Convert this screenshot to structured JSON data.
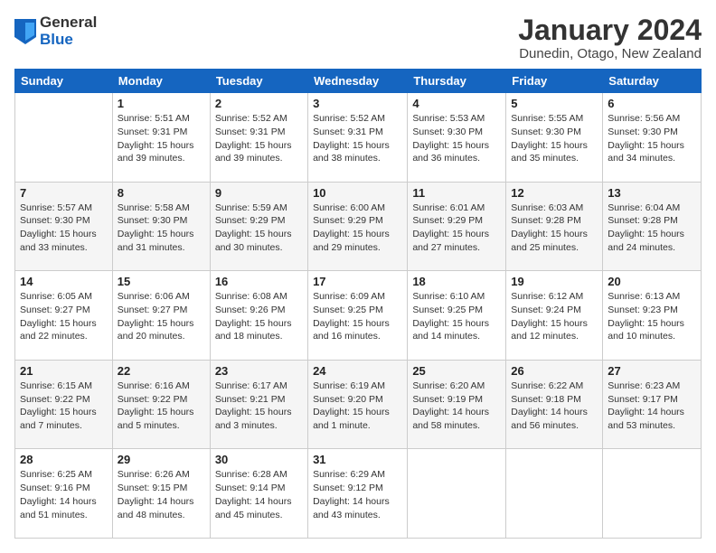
{
  "logo": {
    "general": "General",
    "blue": "Blue"
  },
  "title": "January 2024",
  "subtitle": "Dunedin, Otago, New Zealand",
  "days_header": [
    "Sunday",
    "Monday",
    "Tuesday",
    "Wednesday",
    "Thursday",
    "Friday",
    "Saturday"
  ],
  "weeks": [
    [
      {
        "day": "",
        "info": ""
      },
      {
        "day": "1",
        "info": "Sunrise: 5:51 AM\nSunset: 9:31 PM\nDaylight: 15 hours\nand 39 minutes."
      },
      {
        "day": "2",
        "info": "Sunrise: 5:52 AM\nSunset: 9:31 PM\nDaylight: 15 hours\nand 39 minutes."
      },
      {
        "day": "3",
        "info": "Sunrise: 5:52 AM\nSunset: 9:31 PM\nDaylight: 15 hours\nand 38 minutes."
      },
      {
        "day": "4",
        "info": "Sunrise: 5:53 AM\nSunset: 9:30 PM\nDaylight: 15 hours\nand 36 minutes."
      },
      {
        "day": "5",
        "info": "Sunrise: 5:55 AM\nSunset: 9:30 PM\nDaylight: 15 hours\nand 35 minutes."
      },
      {
        "day": "6",
        "info": "Sunrise: 5:56 AM\nSunset: 9:30 PM\nDaylight: 15 hours\nand 34 minutes."
      }
    ],
    [
      {
        "day": "7",
        "info": "Sunrise: 5:57 AM\nSunset: 9:30 PM\nDaylight: 15 hours\nand 33 minutes."
      },
      {
        "day": "8",
        "info": "Sunrise: 5:58 AM\nSunset: 9:30 PM\nDaylight: 15 hours\nand 31 minutes."
      },
      {
        "day": "9",
        "info": "Sunrise: 5:59 AM\nSunset: 9:29 PM\nDaylight: 15 hours\nand 30 minutes."
      },
      {
        "day": "10",
        "info": "Sunrise: 6:00 AM\nSunset: 9:29 PM\nDaylight: 15 hours\nand 29 minutes."
      },
      {
        "day": "11",
        "info": "Sunrise: 6:01 AM\nSunset: 9:29 PM\nDaylight: 15 hours\nand 27 minutes."
      },
      {
        "day": "12",
        "info": "Sunrise: 6:03 AM\nSunset: 9:28 PM\nDaylight: 15 hours\nand 25 minutes."
      },
      {
        "day": "13",
        "info": "Sunrise: 6:04 AM\nSunset: 9:28 PM\nDaylight: 15 hours\nand 24 minutes."
      }
    ],
    [
      {
        "day": "14",
        "info": "Sunrise: 6:05 AM\nSunset: 9:27 PM\nDaylight: 15 hours\nand 22 minutes."
      },
      {
        "day": "15",
        "info": "Sunrise: 6:06 AM\nSunset: 9:27 PM\nDaylight: 15 hours\nand 20 minutes."
      },
      {
        "day": "16",
        "info": "Sunrise: 6:08 AM\nSunset: 9:26 PM\nDaylight: 15 hours\nand 18 minutes."
      },
      {
        "day": "17",
        "info": "Sunrise: 6:09 AM\nSunset: 9:25 PM\nDaylight: 15 hours\nand 16 minutes."
      },
      {
        "day": "18",
        "info": "Sunrise: 6:10 AM\nSunset: 9:25 PM\nDaylight: 15 hours\nand 14 minutes."
      },
      {
        "day": "19",
        "info": "Sunrise: 6:12 AM\nSunset: 9:24 PM\nDaylight: 15 hours\nand 12 minutes."
      },
      {
        "day": "20",
        "info": "Sunrise: 6:13 AM\nSunset: 9:23 PM\nDaylight: 15 hours\nand 10 minutes."
      }
    ],
    [
      {
        "day": "21",
        "info": "Sunrise: 6:15 AM\nSunset: 9:22 PM\nDaylight: 15 hours\nand 7 minutes."
      },
      {
        "day": "22",
        "info": "Sunrise: 6:16 AM\nSunset: 9:22 PM\nDaylight: 15 hours\nand 5 minutes."
      },
      {
        "day": "23",
        "info": "Sunrise: 6:17 AM\nSunset: 9:21 PM\nDaylight: 15 hours\nand 3 minutes."
      },
      {
        "day": "24",
        "info": "Sunrise: 6:19 AM\nSunset: 9:20 PM\nDaylight: 15 hours\nand 1 minute."
      },
      {
        "day": "25",
        "info": "Sunrise: 6:20 AM\nSunset: 9:19 PM\nDaylight: 14 hours\nand 58 minutes."
      },
      {
        "day": "26",
        "info": "Sunrise: 6:22 AM\nSunset: 9:18 PM\nDaylight: 14 hours\nand 56 minutes."
      },
      {
        "day": "27",
        "info": "Sunrise: 6:23 AM\nSunset: 9:17 PM\nDaylight: 14 hours\nand 53 minutes."
      }
    ],
    [
      {
        "day": "28",
        "info": "Sunrise: 6:25 AM\nSunset: 9:16 PM\nDaylight: 14 hours\nand 51 minutes."
      },
      {
        "day": "29",
        "info": "Sunrise: 6:26 AM\nSunset: 9:15 PM\nDaylight: 14 hours\nand 48 minutes."
      },
      {
        "day": "30",
        "info": "Sunrise: 6:28 AM\nSunset: 9:14 PM\nDaylight: 14 hours\nand 45 minutes."
      },
      {
        "day": "31",
        "info": "Sunrise: 6:29 AM\nSunset: 9:12 PM\nDaylight: 14 hours\nand 43 minutes."
      },
      {
        "day": "",
        "info": ""
      },
      {
        "day": "",
        "info": ""
      },
      {
        "day": "",
        "info": ""
      }
    ]
  ]
}
